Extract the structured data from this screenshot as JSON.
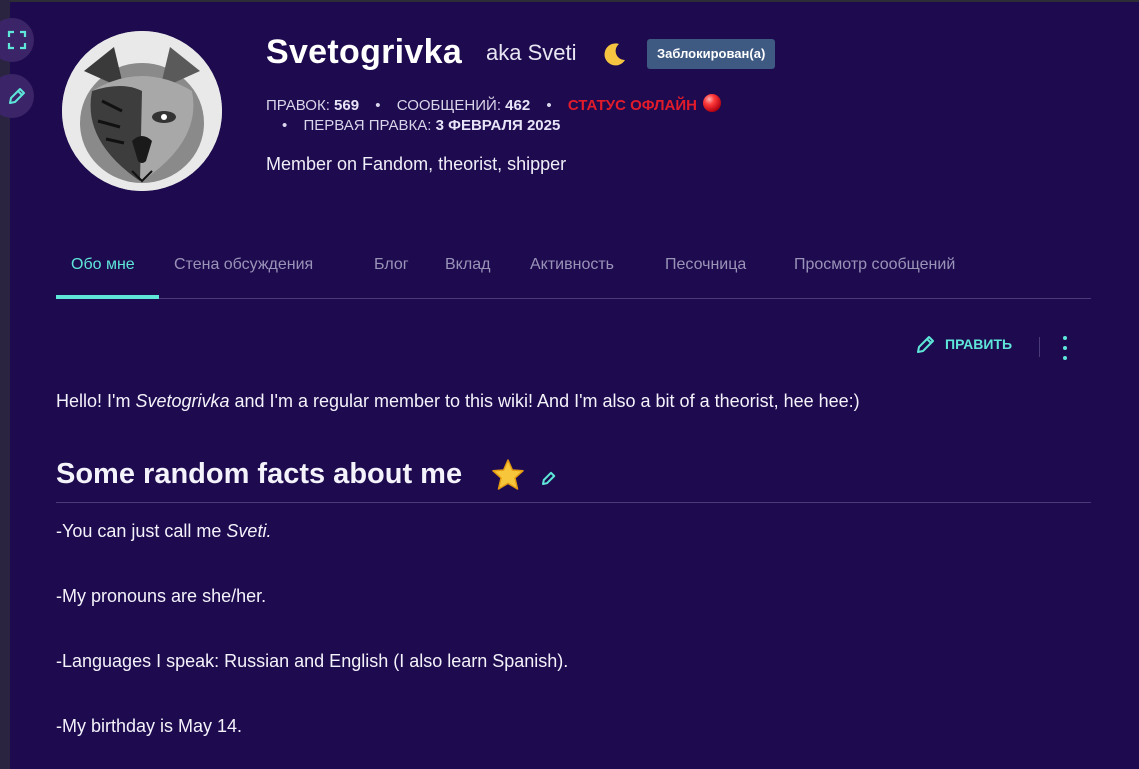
{
  "profile": {
    "username": "Svetogrivka",
    "aka": "aka Sveti",
    "status_badge": "Заблокирован(а)",
    "edits_label": "ПРАВОК:",
    "edits_value": "569",
    "posts_label": "СООБЩЕНИЙ:",
    "posts_value": "462",
    "online_status": "СТАТУС ОФЛАЙН",
    "first_edit_label": "ПЕРВАЯ ПРАВКА:",
    "first_edit_value": "3 ФЕВРАЛЯ 2025",
    "bio": "Member on Fandom, theorist, shipper"
  },
  "tabs": [
    {
      "label": "Обо мне",
      "active": true
    },
    {
      "label": "Стена обсуждения"
    },
    {
      "label": "Блог"
    },
    {
      "label": "Вклад"
    },
    {
      "label": "Активность"
    },
    {
      "label": "Песочница"
    },
    {
      "label": "Просмотр сообщений"
    }
  ],
  "toolbar": {
    "edit_label": "ПРАВИТЬ"
  },
  "content": {
    "intro_pre": "Hello! I'm ",
    "intro_name": "Svetogrivka",
    "intro_post": " and I'm a regular member to this wiki! And I'm also a bit of a theorist, hee hee:)",
    "section_title": "Some random facts about me",
    "facts": [
      {
        "pre": "-You can just call me ",
        "em": "Sveti."
      },
      {
        "pre": "-My pronouns are she/her."
      },
      {
        "pre": "-Languages I speak: Russian and English (I also learn Spanish)."
      },
      {
        "pre": "-My birthday is May 14."
      }
    ]
  },
  "colors": {
    "background": "#1e0b4f",
    "accent": "#5ee6d9",
    "offline": "#e21b2b",
    "badge": "#3e5a83"
  },
  "icons": [
    "fullscreen-icon",
    "pencil-icon",
    "crescent-moon-icon",
    "red-ball-icon",
    "star-icon",
    "kebab-menu-icon"
  ]
}
